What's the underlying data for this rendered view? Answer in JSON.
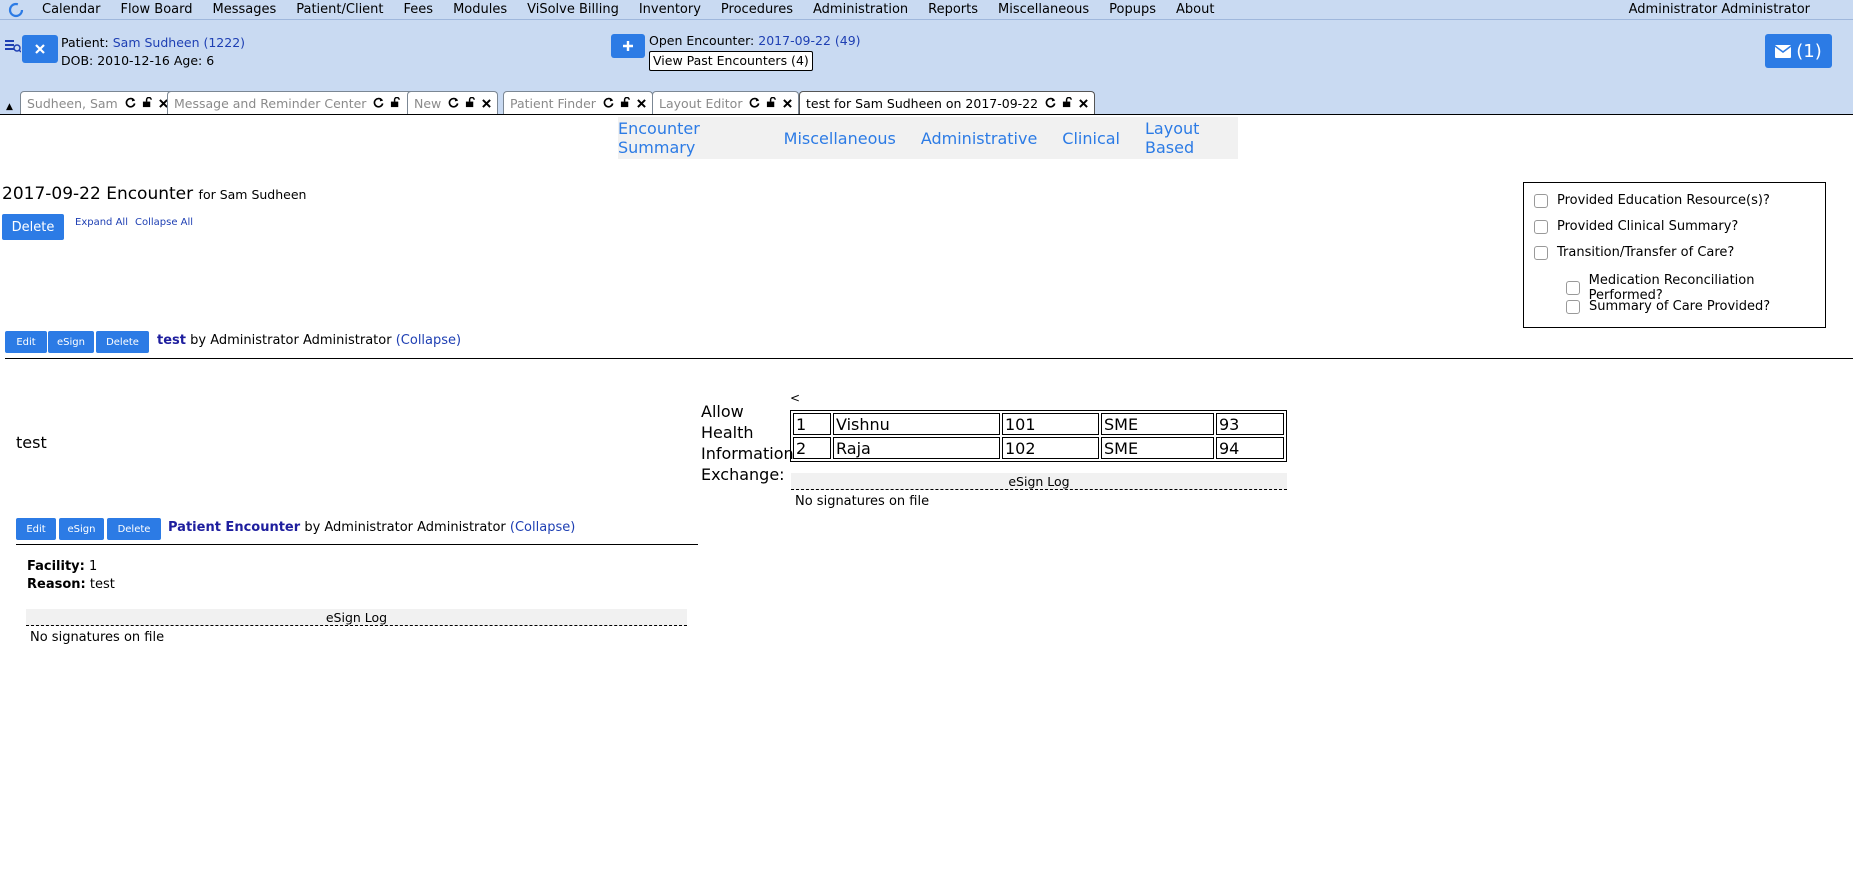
{
  "menu": {
    "items": [
      "Calendar",
      "Flow Board",
      "Messages",
      "Patient/Client",
      "Fees",
      "Modules",
      "ViSolve Billing",
      "Inventory",
      "Procedures",
      "Administration",
      "Reports",
      "Miscellaneous",
      "Popups",
      "About"
    ],
    "user": "Administrator Administrator"
  },
  "patient": {
    "label": "Patient:",
    "name": "Sam Sudheen (1222)",
    "dob_age": "DOB: 2010-12-16 Age: 6"
  },
  "encounter": {
    "open_label": "Open Encounter:",
    "open_value": "2017-09-22 (49)",
    "past_button": "View Past Encounters (4)"
  },
  "mail": {
    "count": "(1)"
  },
  "tabs": [
    {
      "label": "Sudheen, Sam"
    },
    {
      "label": "Message and Reminder Center"
    },
    {
      "label": "New"
    },
    {
      "label": "Patient Finder"
    },
    {
      "label": "Layout Editor"
    },
    {
      "label": "test for Sam Sudheen on 2017-09-22"
    }
  ],
  "nav": [
    "Encounter Summary",
    "Miscellaneous",
    "Administrative",
    "Clinical",
    "Layout Based"
  ],
  "summary": {
    "title": "2017-09-22 Encounter",
    "for": "for Sam Sudheen",
    "delete": "Delete",
    "expand_all": "Expand All",
    "collapse_all": "Collapse All"
  },
  "checklist": [
    "Provided Education Resource(s)?",
    "Provided Clinical Summary?",
    "Transition/Transfer of Care?",
    "Medication Reconciliation Performed?",
    "Summary of Care Provided?"
  ],
  "form1": {
    "edit": "Edit",
    "esign": "eSign",
    "delete": "Delete",
    "name": "test",
    "by": "by Administrator Administrator",
    "collapse": "(Collapse)",
    "body": "test",
    "allow": [
      "Allow",
      "Health",
      "Information",
      "Exchange:"
    ],
    "lt": "<",
    "rows": [
      [
        "1",
        "Vishnu",
        "101",
        "SME",
        "93"
      ],
      [
        "2",
        "Raja",
        "102",
        "SME",
        "94"
      ]
    ],
    "esign_log": "eSign Log",
    "no_sig": "No signatures on file"
  },
  "form2": {
    "edit": "Edit",
    "esign": "eSign",
    "delete": "Delete",
    "name": "Patient Encounter",
    "by": "by Administrator Administrator",
    "collapse": "(Collapse)",
    "facility_label": "Facility:",
    "facility_value": "1",
    "reason_label": "Reason:",
    "reason_value": "test",
    "esign_log": "eSign Log",
    "no_sig": "No signatures on file"
  }
}
